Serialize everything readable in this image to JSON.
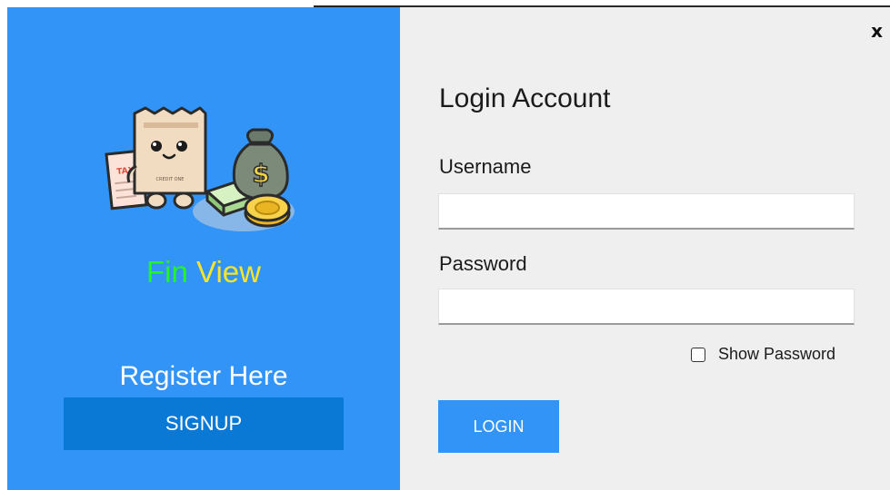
{
  "window": {
    "close_label": "x"
  },
  "left_panel": {
    "brand_part1": "Fin",
    "brand_part2": "View",
    "register_text": "Register Here",
    "signup_label": "SIGNUP",
    "logo_texts": {
      "tax": "TAX",
      "receipt": "CREDIT ONE",
      "dollar": "$"
    }
  },
  "login_form": {
    "title": "Login Account",
    "username_label": "Username",
    "username_value": "",
    "password_label": "Password",
    "password_value": "",
    "show_password_label": "Show Password",
    "login_label": "LOGIN"
  },
  "colors": {
    "left_panel_bg": "#3394f8",
    "signup_bg": "#0a79d6",
    "login_bg": "#3394f8",
    "right_panel_bg": "#efefef",
    "brand_fin": "#26f22b",
    "brand_view": "#f6e52a"
  },
  "icons": {
    "logo": "fin-view-mascot-icon",
    "close": "close-icon"
  }
}
